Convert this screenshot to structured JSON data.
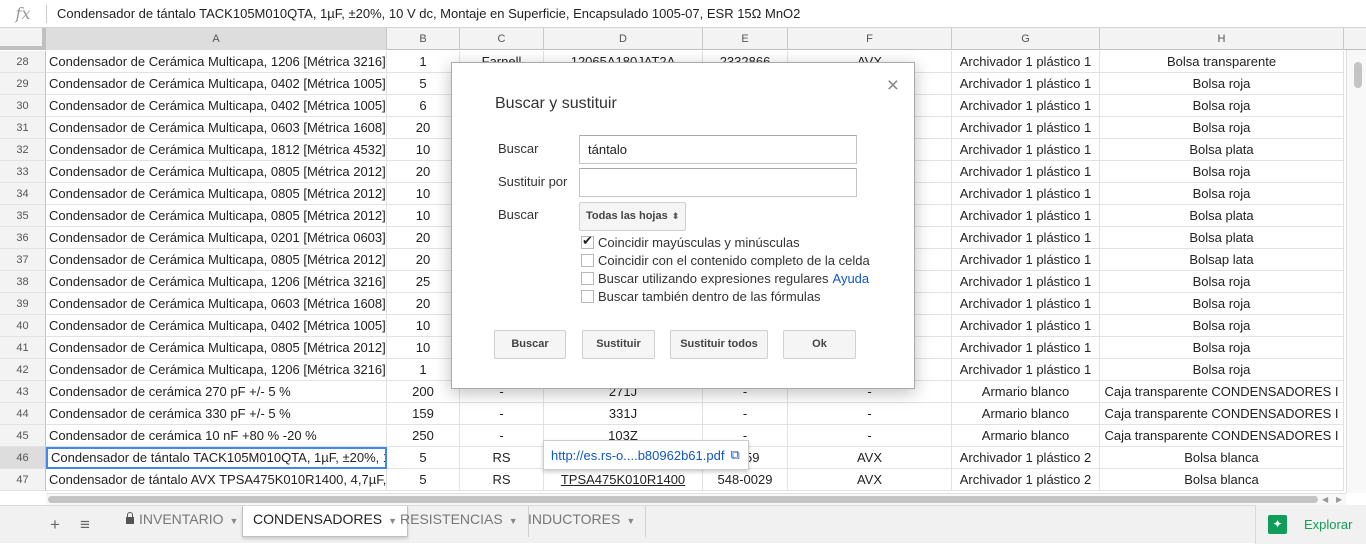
{
  "formula_bar": {
    "fx": "fx",
    "content": "Condensador de tántalo TACK105M010QTA, 1µF, ±20%, 10 V dc, Montaje en Superficie, Encapsulado 1005-07, ESR 15Ω MnO2"
  },
  "columns": [
    "A",
    "B",
    "C",
    "D",
    "E",
    "F",
    "G",
    "H"
  ],
  "rows": [
    {
      "num": "28",
      "a": "Condensador de Cerámica Multicapa, 1206 [Métrica 3216]",
      "b": "1",
      "c": "Farnell",
      "d": "12065A180JAT2A",
      "e": "2332866",
      "f": "AVX",
      "g": "Archivador 1 plástico 1",
      "h": "Bolsa transparente"
    },
    {
      "num": "29",
      "a": "Condensador de Cerámica Multicapa, 0402 [Métrica 1005]",
      "b": "5",
      "c": "",
      "d": "",
      "e": "",
      "f": "",
      "g": "Archivador 1 plástico 1",
      "h": "Bolsa roja"
    },
    {
      "num": "30",
      "a": "Condensador de Cerámica Multicapa, 0402 [Métrica 1005]",
      "b": "6",
      "c": "",
      "d": "",
      "e": "",
      "f": "",
      "g": "Archivador 1 plástico 1",
      "h": "Bolsa roja"
    },
    {
      "num": "31",
      "a": "Condensador de Cerámica Multicapa, 0603 [Métrica 1608]",
      "b": "20",
      "c": "",
      "d": "",
      "e": "",
      "f": "",
      "g": "Archivador 1 plástico 1",
      "h": "Bolsa roja"
    },
    {
      "num": "32",
      "a": "Condensador de Cerámica Multicapa, 1812 [Métrica 4532]",
      "b": "10",
      "c": "",
      "d": "",
      "e": "",
      "f": "",
      "g": "Archivador 1 plástico 1",
      "h": "Bolsa plata"
    },
    {
      "num": "33",
      "a": "Condensador de Cerámica Multicapa, 0805 [Métrica 2012]",
      "b": "20",
      "c": "",
      "d": "",
      "e": "",
      "f": "",
      "g": "Archivador 1 plástico 1",
      "h": "Bolsa roja"
    },
    {
      "num": "34",
      "a": "Condensador de Cerámica Multicapa, 0805 [Métrica 2012]",
      "b": "10",
      "c": "",
      "d": "",
      "e": "",
      "f": "",
      "g": "Archivador 1 plástico 1",
      "h": "Bolsa roja"
    },
    {
      "num": "35",
      "a": "Condensador de Cerámica Multicapa, 0805 [Métrica 2012]",
      "b": "10",
      "c": "",
      "d": "",
      "e": "",
      "f": "",
      "g": "Archivador 1 plástico 1",
      "h": "Bolsa plata"
    },
    {
      "num": "36",
      "a": "Condensador de Cerámica Multicapa, 0201 [Métrica 0603]",
      "b": "20",
      "c": "",
      "d": "",
      "e": "",
      "f": "P)",
      "g": "Archivador 1 plástico 1",
      "h": "Bolsa plata"
    },
    {
      "num": "37",
      "a": "Condensador de Cerámica Multicapa, 0805 [Métrica 2012]",
      "b": "20",
      "c": "",
      "d": "",
      "e": "",
      "f": "",
      "g": "Archivador 1 plástico 1",
      "h": "Bolsap lata"
    },
    {
      "num": "38",
      "a": "Condensador de Cerámica Multicapa, 1206 [Métrica 3216]",
      "b": "25",
      "c": "",
      "d": "",
      "e": "",
      "f": "",
      "g": "Archivador 1 plástico 1",
      "h": "Bolsa roja"
    },
    {
      "num": "39",
      "a": "Condensador de Cerámica Multicapa, 0603 [Métrica 1608]",
      "b": "20",
      "c": "",
      "d": "",
      "e": "",
      "f": "",
      "g": "Archivador 1 plástico 1",
      "h": "Bolsa roja"
    },
    {
      "num": "40",
      "a": "Condensador de Cerámica Multicapa, 0402 [Métrica 1005]",
      "b": "10",
      "c": "",
      "d": "",
      "e": "",
      "f": "",
      "g": "Archivador 1 plástico 1",
      "h": "Bolsa roja"
    },
    {
      "num": "41",
      "a": "Condensador de Cerámica Multicapa, 0805 [Métrica 2012]",
      "b": "10",
      "c": "",
      "d": "",
      "e": "",
      "f": "",
      "g": "Archivador 1 plástico 1",
      "h": "Bolsa roja"
    },
    {
      "num": "42",
      "a": "Condensador de Cerámica Multicapa, 1206 [Métrica 3216]",
      "b": "1",
      "c": "",
      "d": "",
      "e": "",
      "f": "",
      "g": "Archivador 1 plástico 1",
      "h": "Bolsa roja"
    },
    {
      "num": "43",
      "a": "Condensador de cerámica 270 pF +/- 5 %",
      "b": "200",
      "c": "-",
      "d": "271J",
      "e": "-",
      "f": "-",
      "g": "Armario blanco",
      "h": "Caja transparente CONDENSADORES I"
    },
    {
      "num": "44",
      "a": "Condensador de cerámica 330 pF +/- 5 %",
      "b": "159",
      "c": "-",
      "d": "331J",
      "e": "-",
      "f": "-",
      "g": "Armario blanco",
      "h": "Caja transparente CONDENSADORES I"
    },
    {
      "num": "45",
      "a": "Condensador de cerámica 10 nF +80 % -20 %",
      "b": "250",
      "c": "-",
      "d": "103Z",
      "e": "-",
      "f": "-",
      "g": "Armario blanco",
      "h": "Caja transparente CONDENSADORES I"
    },
    {
      "num": "46",
      "a": "Condensador de tántalo TACK105M010QTA, 1µF, ±20%, 10",
      "b": "5",
      "c": "RS",
      "d": "",
      "e": "4059",
      "f": "AVX",
      "g": "Archivador 1 plástico 2",
      "h": "Bolsa blanca"
    },
    {
      "num": "47",
      "a": "Condensador de tántalo AVX TPSA475K010R1400, 4,7µF, ±",
      "b": "5",
      "c": "RS",
      "d": "TPSA475K010R1400",
      "e": "548-0029",
      "f": "AVX",
      "g": "Archivador 1 plástico 2",
      "h": "Bolsa blanca"
    }
  ],
  "link_tooltip": {
    "url": "http://es.rs-o....b80962b61.pdf",
    "icon": "open-in-new-icon"
  },
  "dialog": {
    "title": "Buscar y sustituir",
    "close": "×",
    "find_label": "Buscar",
    "find_value": "tántalo",
    "replace_label": "Sustituir por",
    "replace_value": "",
    "scope_label": "Buscar",
    "scope_value": "Todas las hojas",
    "options": [
      {
        "label": "Coincidir mayúsculas y minúsculas",
        "checked": true
      },
      {
        "label": "Coincidir con el contenido completo de la celda",
        "checked": false
      },
      {
        "label": "Buscar utilizando expresiones regulares",
        "checked": false,
        "link": "Ayuda"
      },
      {
        "label": "Buscar también dentro de las fórmulas",
        "checked": false
      }
    ],
    "buttons": {
      "find": "Buscar",
      "replace": "Sustituir",
      "replace_all": "Sustituir todos",
      "ok": "Ok"
    }
  },
  "tabs": {
    "add": "+",
    "list": "≡",
    "sheets": [
      "INVENTARIO",
      "CONDENSADORES",
      "RESISTENCIAS",
      "INDUCTORES"
    ],
    "active": "CONDENSADORES",
    "explore_label": "Explorar",
    "explore_color": "#0f9d58"
  }
}
